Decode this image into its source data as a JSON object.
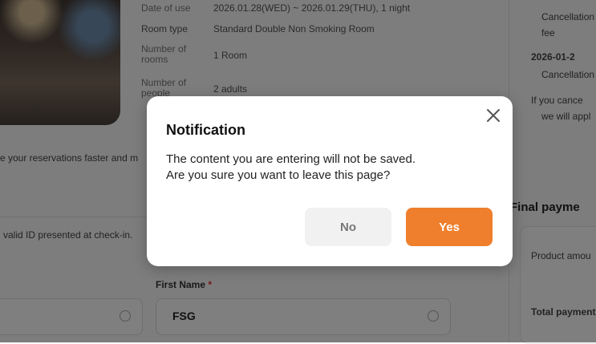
{
  "reservation": {
    "date_of_use_label": "Date of use",
    "date_of_use_value": "2026.01.28(WED) ~ 2026.01.29(THU), 1 night",
    "room_type_label": "Room type",
    "room_type_value": "Standard Double Non Smoking Room",
    "rooms_label": "Number of rooms",
    "rooms_value": "1 Room",
    "people_label": "Number of people",
    "people_value": "2 adults"
  },
  "background": {
    "faster_text": "e your reservations faster and m",
    "id_notice": "valid ID presented at check-in.",
    "first_name_label": "First Name",
    "required_mark": "*",
    "first_name_value": "FSG",
    "cancellation_1": "Cancellation",
    "cancellation_fee": "fee",
    "date_2": "2026-01-2",
    "cancellation_2": "Cancellation",
    "if_cancel": "If you cance",
    "will_apply": "we will appl",
    "final_payment": "Final payme",
    "product_amount": "Product amou",
    "total_payment": "Total payment"
  },
  "modal": {
    "title": "Notification",
    "message_line1": "The content you are entering will not be saved.",
    "message_line2": "Are you sure you want to leave this page?",
    "no_label": "No",
    "yes_label": "Yes"
  },
  "colors": {
    "accent": "#ef7f2c",
    "overlay": "rgba(0,0,0,0.5)"
  }
}
